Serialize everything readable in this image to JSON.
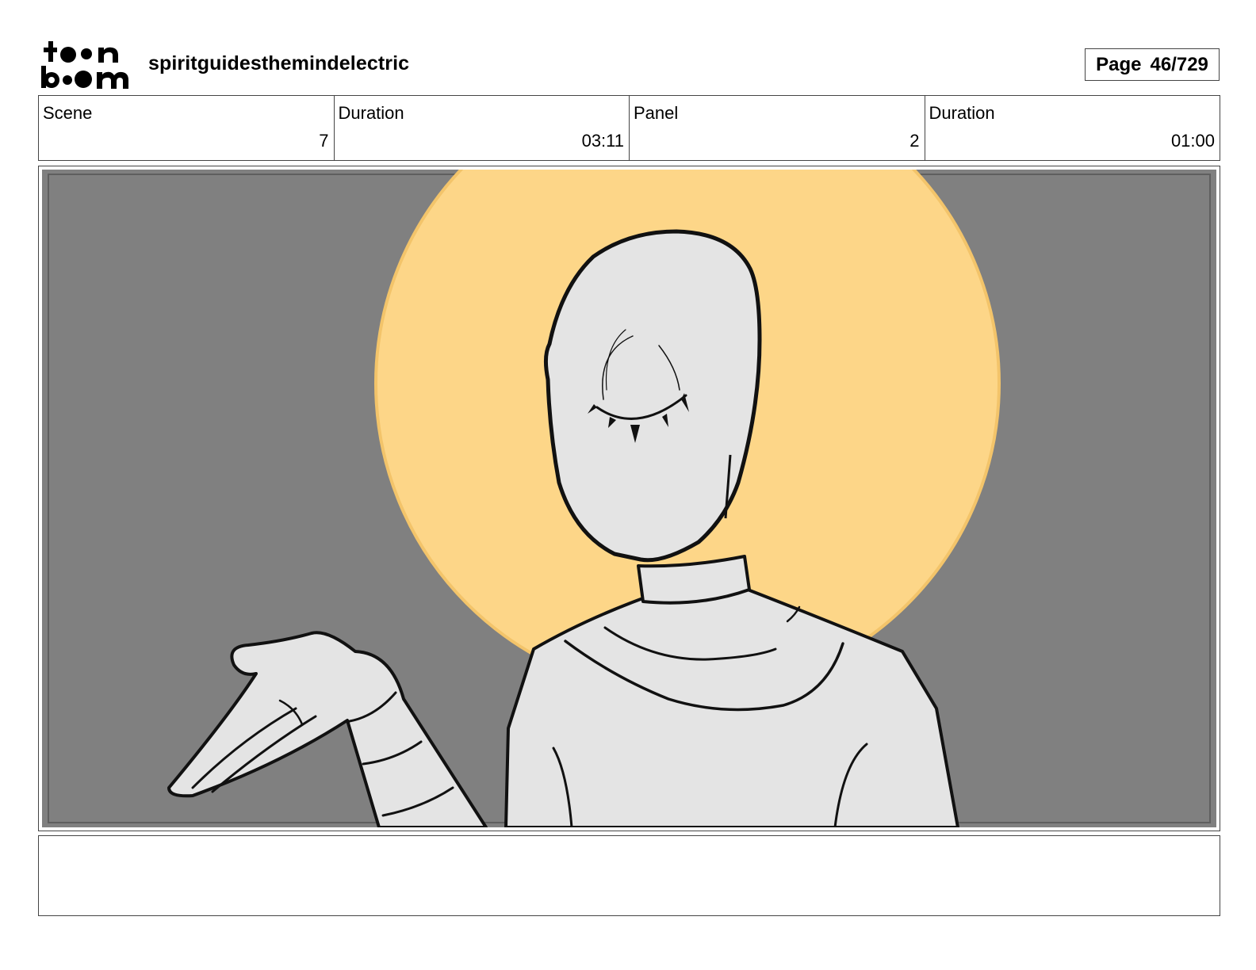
{
  "header": {
    "logo_line1": "toon",
    "logo_line2": "boom",
    "project_title": "spiritguidesthemindelectric",
    "page_label": "Page",
    "page_number": "46/729"
  },
  "info": {
    "scene_label": "Scene",
    "scene_value": "7",
    "scene_duration_label": "Duration",
    "scene_duration_value": "03:11",
    "panel_label": "Panel",
    "panel_value": "2",
    "panel_duration_label": "Duration",
    "panel_duration_value": "01:00"
  },
  "colors": {
    "background_gray": "#808080",
    "halo": "#fdd688",
    "skin": "#e4e4e4"
  },
  "notes": {
    "text": ""
  }
}
